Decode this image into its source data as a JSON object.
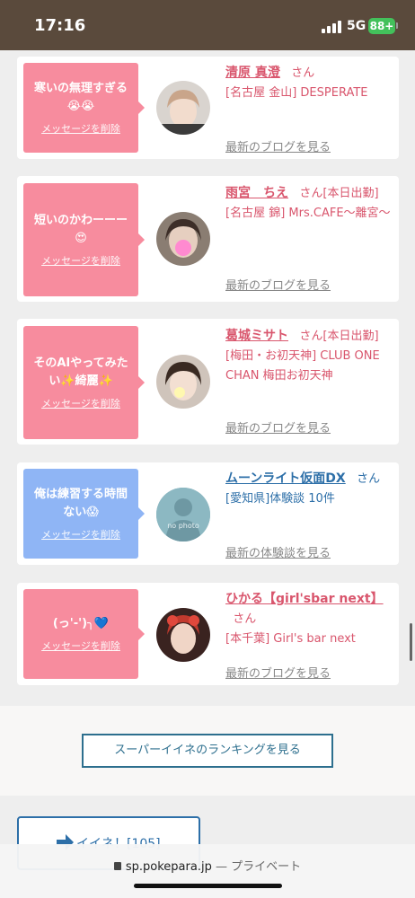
{
  "status_bar": {
    "time": "17:16",
    "network": "5G",
    "battery": "88+"
  },
  "cards": [
    {
      "message": "寒いの無理すぎる😭😭",
      "delete_label": "メッセージを削除",
      "name": "清原 真澄",
      "suffix": "さん",
      "store": "[名古屋 金山] DESPERATE",
      "link": "最新のブログを見る",
      "bubble_color": "#f78c9e"
    },
    {
      "message": "短いのかわーーー😍",
      "delete_label": "メッセージを削除",
      "name": "雨宮　ちえ",
      "suffix": "さん[本日出勤]",
      "store": "[名古屋 錦] Mrs.CAFE～離宮～",
      "link": "最新のブログを見る",
      "bubble_color": "#f78c9e"
    },
    {
      "message": "そのAIやってみたい✨綺麗✨",
      "delete_label": "メッセージを削除",
      "name": "葛城ミサト",
      "suffix": "さん[本日出勤]",
      "store": "[梅田・お初天神] CLUB ONE CHAN 梅田お初天神",
      "link": "最新のブログを見る",
      "bubble_color": "#f78c9e"
    },
    {
      "message": "俺は練習する時間ない😱",
      "delete_label": "メッセージを削除",
      "name": "ムーンライト仮面DX",
      "suffix": "さん",
      "store": "[愛知県]体験談 10件",
      "link": "最新の体験談を見る",
      "avatar_text": "no photo",
      "bubble_color": "#8fb5f5"
    },
    {
      "message": "(っ'-')╮💙",
      "delete_label": "メッセージを削除",
      "name": "ひかる【girl'sbar next】",
      "suffix": "さん",
      "store": "[本千葉] Girl's bar next",
      "link": "最新のブログを見る",
      "bubble_color": "#f78c9e"
    }
  ],
  "ranking_button": "スーパーイイネのランキングを見る",
  "iine_button": "イイネ！[105]",
  "browser": {
    "url": "sp.pokepara.jp",
    "privacy": "— プライベート"
  }
}
